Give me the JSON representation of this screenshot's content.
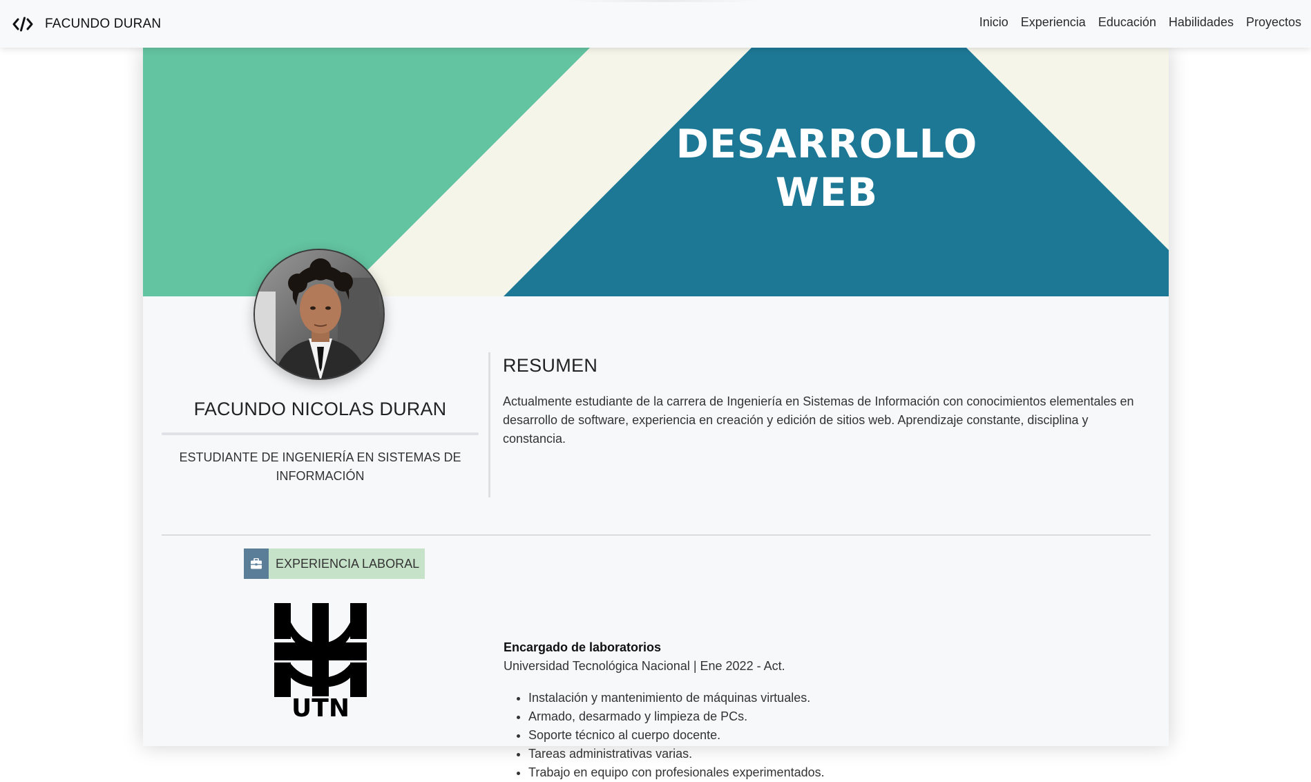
{
  "navbar": {
    "brand_icon": "code-icon",
    "brand": "FACUNDO DURAN",
    "links": [
      "Inicio",
      "Experiencia",
      "Educación",
      "Habilidades",
      "Proyectos"
    ]
  },
  "banner": {
    "title_line1": "DESARROLLO",
    "title_line2": "WEB",
    "colors": {
      "green": "#63c4a1",
      "cream": "#f5f5ea",
      "teal": "#1d7896"
    }
  },
  "profile": {
    "avatar": "profile-photo",
    "name": "FACUNDO NICOLAS DURAN",
    "role": "ESTUDIANTE DE INGENIERÍA EN SISTEMAS DE INFORMACIÓN"
  },
  "summary": {
    "title": "RESUMEN",
    "text": "Actualmente estudiante de la carrera de Ingeniería en Sistemas de Información con conocimientos elementales en desarrollo de software, experiencia en creación y edición de sitios web. Aprendizaje constante, disciplina y constancia."
  },
  "experience": {
    "section_icon": "briefcase-icon",
    "section_label": "EXPERIENCIA LABORAL",
    "logo": "utn-logo",
    "logo_text": "UTN",
    "job_title": "Encargado de laboratorios",
    "job_org": "Universidad Tecnológica Nacional | Ene 2022 - Act.",
    "tasks": [
      "Instalación y mantenimiento de máquinas virtuales.",
      "Armado, desarmado y limpieza de PCs.",
      "Soporte técnico al cuerpo docente.",
      "Tareas administrativas varias.",
      "Trabajo en equipo con profesionales experimentados."
    ]
  }
}
